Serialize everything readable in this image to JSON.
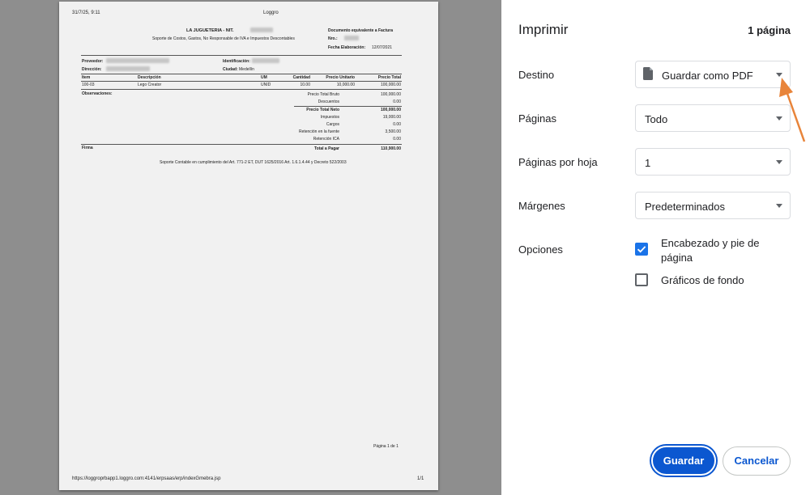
{
  "preview": {
    "header_datetime": "31/7/25, 9:11",
    "header_title": "Loggro",
    "company_title": "LA JUGUETERIA - NIT.",
    "company_subtitle": "Soporte de Costos, Gastos, No Responsable de IVA e Impuestos Descontables",
    "doc_type": "Documento equivalente a Factura",
    "doc_no_label": "Nro.:",
    "fecha_label": "Fecha Elaboración:",
    "fecha_value": "12/07/2021",
    "proveedor_label": "Proveedor:",
    "direccion_label": "Dirección:",
    "identificacion_label": "Identificación:",
    "ciudad_label": "Ciudad:",
    "ciudad_value": "Medellín",
    "table_headers": [
      "Item",
      "Descripción",
      "UM",
      "Cantidad",
      "Precio Unitario",
      "Precio Total"
    ],
    "table_row": [
      "100-03",
      "Lego Creator",
      "UNID",
      "10.00",
      "10,000.00",
      "100,000.00"
    ],
    "observaciones_label": "Observaciones:",
    "totals": [
      {
        "label": "Precio Total Bruto",
        "value": "100,000.00"
      },
      {
        "label": "Descuentos",
        "value": "0.00"
      },
      {
        "label": "Precio Total Neto",
        "value": "100,000.00"
      },
      {
        "label": "Impuestos",
        "value": "19,000.00"
      },
      {
        "label": "Cargos",
        "value": "0.00"
      },
      {
        "label": "Retención en la fuente",
        "value": "3,500.00"
      },
      {
        "label": "Retención ICA",
        "value": "0.00"
      },
      {
        "label": "Total a Pagar",
        "value": "110,900.00"
      }
    ],
    "firma_label": "Firma",
    "legal_note": "Soporte Contable en cumplimiento del Art. 771-2 ET, DUT 1625/2016 Art. 1.6.1.4.44 y Decreto 522/2003",
    "page_of": "Página 1 de 1",
    "footer_url": "https://loggroprbapp1.loggro.com:4141/erpsaas/erp/indexGmebra.jsp",
    "footer_page": "1/1"
  },
  "panel": {
    "title": "Imprimir",
    "page_count": "1 página",
    "destino_label": "Destino",
    "destino_value": "Guardar como PDF",
    "paginas_label": "Páginas",
    "paginas_value": "Todo",
    "por_hoja_label": "Páginas por hoja",
    "por_hoja_value": "1",
    "margenes_label": "Márgenes",
    "margenes_value": "Predeterminados",
    "opciones_label": "Opciones",
    "opt_header_footer": "Encabezado y pie de página",
    "opt_header_footer_checked": true,
    "opt_background": "Gráficos de fondo",
    "opt_background_checked": false,
    "save_label": "Guardar",
    "cancel_label": "Cancelar"
  },
  "colors": {
    "accent": "#0b57d0",
    "checkbox": "#1a73e8",
    "annotation_arrow": "#e8843a"
  },
  "icons": {
    "destino_icon": "file-icon",
    "dropdown_icon": "caret-down-icon",
    "check_icon": "checkmark-icon"
  }
}
